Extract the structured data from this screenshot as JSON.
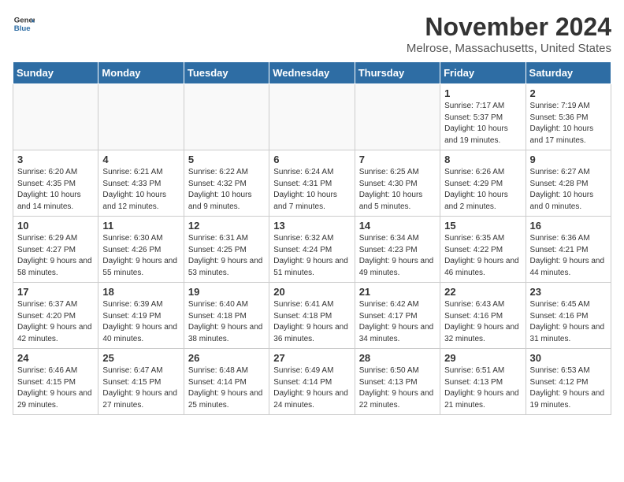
{
  "logo": {
    "general": "General",
    "blue": "Blue"
  },
  "title": "November 2024",
  "location": "Melrose, Massachusetts, United States",
  "weekdays": [
    "Sunday",
    "Monday",
    "Tuesday",
    "Wednesday",
    "Thursday",
    "Friday",
    "Saturday"
  ],
  "weeks": [
    [
      {
        "day": "",
        "detail": ""
      },
      {
        "day": "",
        "detail": ""
      },
      {
        "day": "",
        "detail": ""
      },
      {
        "day": "",
        "detail": ""
      },
      {
        "day": "",
        "detail": ""
      },
      {
        "day": "1",
        "detail": "Sunrise: 7:17 AM\nSunset: 5:37 PM\nDaylight: 10 hours and 19 minutes."
      },
      {
        "day": "2",
        "detail": "Sunrise: 7:19 AM\nSunset: 5:36 PM\nDaylight: 10 hours and 17 minutes."
      }
    ],
    [
      {
        "day": "3",
        "detail": "Sunrise: 6:20 AM\nSunset: 4:35 PM\nDaylight: 10 hours and 14 minutes."
      },
      {
        "day": "4",
        "detail": "Sunrise: 6:21 AM\nSunset: 4:33 PM\nDaylight: 10 hours and 12 minutes."
      },
      {
        "day": "5",
        "detail": "Sunrise: 6:22 AM\nSunset: 4:32 PM\nDaylight: 10 hours and 9 minutes."
      },
      {
        "day": "6",
        "detail": "Sunrise: 6:24 AM\nSunset: 4:31 PM\nDaylight: 10 hours and 7 minutes."
      },
      {
        "day": "7",
        "detail": "Sunrise: 6:25 AM\nSunset: 4:30 PM\nDaylight: 10 hours and 5 minutes."
      },
      {
        "day": "8",
        "detail": "Sunrise: 6:26 AM\nSunset: 4:29 PM\nDaylight: 10 hours and 2 minutes."
      },
      {
        "day": "9",
        "detail": "Sunrise: 6:27 AM\nSunset: 4:28 PM\nDaylight: 10 hours and 0 minutes."
      }
    ],
    [
      {
        "day": "10",
        "detail": "Sunrise: 6:29 AM\nSunset: 4:27 PM\nDaylight: 9 hours and 58 minutes."
      },
      {
        "day": "11",
        "detail": "Sunrise: 6:30 AM\nSunset: 4:26 PM\nDaylight: 9 hours and 55 minutes."
      },
      {
        "day": "12",
        "detail": "Sunrise: 6:31 AM\nSunset: 4:25 PM\nDaylight: 9 hours and 53 minutes."
      },
      {
        "day": "13",
        "detail": "Sunrise: 6:32 AM\nSunset: 4:24 PM\nDaylight: 9 hours and 51 minutes."
      },
      {
        "day": "14",
        "detail": "Sunrise: 6:34 AM\nSunset: 4:23 PM\nDaylight: 9 hours and 49 minutes."
      },
      {
        "day": "15",
        "detail": "Sunrise: 6:35 AM\nSunset: 4:22 PM\nDaylight: 9 hours and 46 minutes."
      },
      {
        "day": "16",
        "detail": "Sunrise: 6:36 AM\nSunset: 4:21 PM\nDaylight: 9 hours and 44 minutes."
      }
    ],
    [
      {
        "day": "17",
        "detail": "Sunrise: 6:37 AM\nSunset: 4:20 PM\nDaylight: 9 hours and 42 minutes."
      },
      {
        "day": "18",
        "detail": "Sunrise: 6:39 AM\nSunset: 4:19 PM\nDaylight: 9 hours and 40 minutes."
      },
      {
        "day": "19",
        "detail": "Sunrise: 6:40 AM\nSunset: 4:18 PM\nDaylight: 9 hours and 38 minutes."
      },
      {
        "day": "20",
        "detail": "Sunrise: 6:41 AM\nSunset: 4:18 PM\nDaylight: 9 hours and 36 minutes."
      },
      {
        "day": "21",
        "detail": "Sunrise: 6:42 AM\nSunset: 4:17 PM\nDaylight: 9 hours and 34 minutes."
      },
      {
        "day": "22",
        "detail": "Sunrise: 6:43 AM\nSunset: 4:16 PM\nDaylight: 9 hours and 32 minutes."
      },
      {
        "day": "23",
        "detail": "Sunrise: 6:45 AM\nSunset: 4:16 PM\nDaylight: 9 hours and 31 minutes."
      }
    ],
    [
      {
        "day": "24",
        "detail": "Sunrise: 6:46 AM\nSunset: 4:15 PM\nDaylight: 9 hours and 29 minutes."
      },
      {
        "day": "25",
        "detail": "Sunrise: 6:47 AM\nSunset: 4:15 PM\nDaylight: 9 hours and 27 minutes."
      },
      {
        "day": "26",
        "detail": "Sunrise: 6:48 AM\nSunset: 4:14 PM\nDaylight: 9 hours and 25 minutes."
      },
      {
        "day": "27",
        "detail": "Sunrise: 6:49 AM\nSunset: 4:14 PM\nDaylight: 9 hours and 24 minutes."
      },
      {
        "day": "28",
        "detail": "Sunrise: 6:50 AM\nSunset: 4:13 PM\nDaylight: 9 hours and 22 minutes."
      },
      {
        "day": "29",
        "detail": "Sunrise: 6:51 AM\nSunset: 4:13 PM\nDaylight: 9 hours and 21 minutes."
      },
      {
        "day": "30",
        "detail": "Sunrise: 6:53 AM\nSunset: 4:12 PM\nDaylight: 9 hours and 19 minutes."
      }
    ]
  ]
}
